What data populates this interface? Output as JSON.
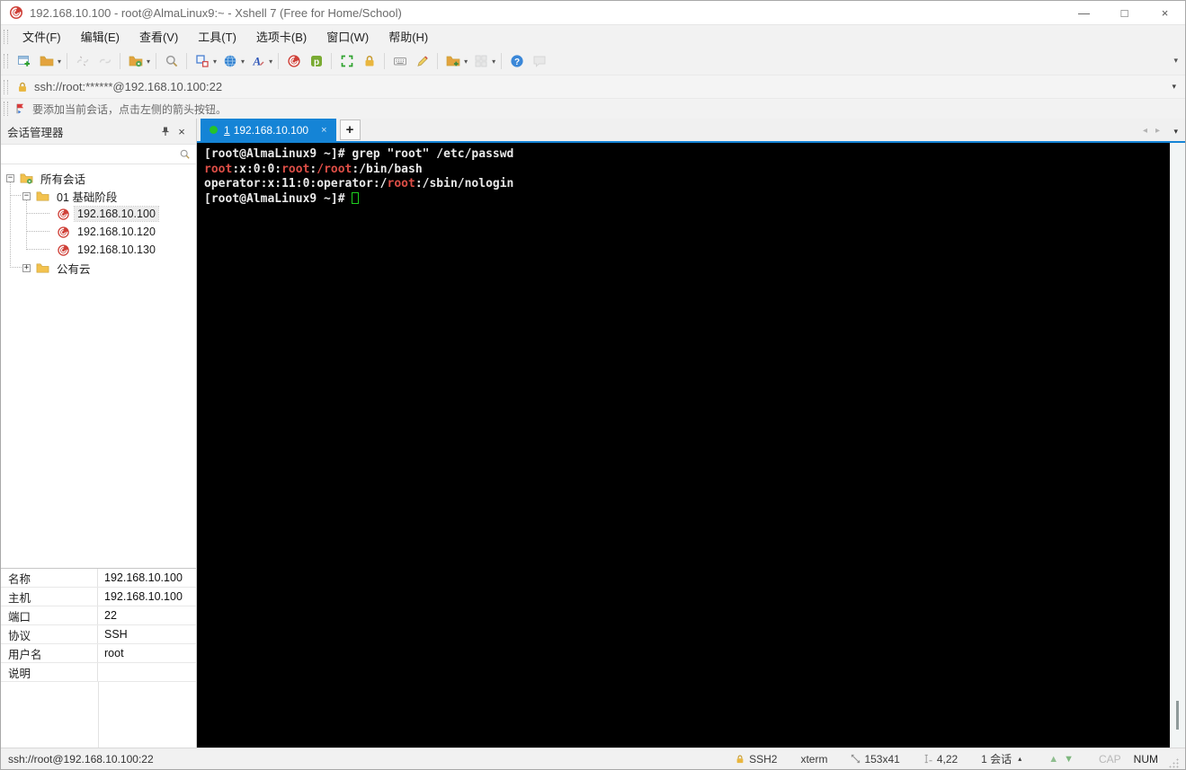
{
  "window": {
    "title": "192.168.10.100 - root@AlmaLinux9:~ - Xshell 7 (Free for Home/School)",
    "minimize": "—",
    "maximize": "□",
    "close": "×"
  },
  "menu_bar": {
    "items": [
      "文件(F)",
      "编辑(E)",
      "查看(V)",
      "工具(T)",
      "选项卡(B)",
      "窗口(W)",
      "帮助(H)"
    ]
  },
  "toolbar": {
    "buttons": [
      {
        "name": "new-session",
        "enabled": true,
        "dropdown": false,
        "sep_after": false
      },
      {
        "name": "open-session",
        "enabled": true,
        "dropdown": true,
        "sep_after": true
      },
      {
        "name": "disconnect",
        "enabled": false,
        "dropdown": false,
        "sep_after": false
      },
      {
        "name": "reconnect",
        "enabled": false,
        "dropdown": false,
        "sep_after": true
      },
      {
        "name": "session-properties",
        "enabled": true,
        "dropdown": true,
        "sep_after": true
      },
      {
        "name": "find",
        "enabled": true,
        "dropdown": false,
        "sep_after": true
      },
      {
        "name": "window-layout",
        "enabled": true,
        "dropdown": true,
        "sep_after": false
      },
      {
        "name": "open-url",
        "enabled": true,
        "dropdown": true,
        "sep_after": false
      },
      {
        "name": "font",
        "enabled": true,
        "dropdown": true,
        "sep_after": true
      },
      {
        "name": "xshell",
        "enabled": true,
        "dropdown": false,
        "sep_after": false
      },
      {
        "name": "xftp",
        "enabled": true,
        "dropdown": false,
        "sep_after": true
      },
      {
        "name": "fullscreen",
        "enabled": true,
        "dropdown": false,
        "sep_after": false
      },
      {
        "name": "lock-screen",
        "enabled": true,
        "dropdown": false,
        "sep_after": true
      },
      {
        "name": "virtual-keyboard",
        "enabled": true,
        "dropdown": false,
        "sep_after": false
      },
      {
        "name": "compose-pane",
        "enabled": true,
        "dropdown": false,
        "sep_after": true
      },
      {
        "name": "quick-commands",
        "enabled": true,
        "dropdown": true,
        "sep_after": false
      },
      {
        "name": "tile-windows",
        "enabled": false,
        "dropdown": true,
        "sep_after": true
      },
      {
        "name": "help",
        "enabled": true,
        "dropdown": false,
        "sep_after": false
      },
      {
        "name": "feedback",
        "enabled": false,
        "dropdown": false,
        "sep_after": false
      }
    ]
  },
  "address_bar": {
    "url": "ssh://root:******@192.168.10.100:22"
  },
  "info_bar": {
    "message": "要添加当前会话，点击左侧的箭头按钮。"
  },
  "session_manager": {
    "title": "会话管理器",
    "search_placeholder": "",
    "tree": [
      {
        "label": "所有会话",
        "type": "root",
        "level": 0,
        "expander": "-",
        "selected": false
      },
      {
        "label": "01 基础阶段",
        "type": "folder",
        "level": 1,
        "expander": "-",
        "selected": false
      },
      {
        "label": "192.168.10.100",
        "type": "session",
        "level": 2,
        "expander": "",
        "selected": true
      },
      {
        "label": "192.168.10.120",
        "type": "session",
        "level": 2,
        "expander": "",
        "selected": false
      },
      {
        "label": "192.168.10.130",
        "type": "session",
        "level": 2,
        "expander": "",
        "selected": false
      },
      {
        "label": "公有云",
        "type": "folder",
        "level": 1,
        "expander": "+",
        "selected": false
      }
    ],
    "properties": [
      {
        "label": "名称",
        "value": "192.168.10.100"
      },
      {
        "label": "主机",
        "value": "192.168.10.100"
      },
      {
        "label": "端口",
        "value": "22"
      },
      {
        "label": "协议",
        "value": "SSH"
      },
      {
        "label": "用户名",
        "value": "root"
      },
      {
        "label": "说明",
        "value": ""
      }
    ]
  },
  "tab_bar": {
    "tabs": [
      {
        "index": "1",
        "label": "192.168.10.100",
        "close": "×",
        "active": true
      }
    ],
    "new_tab_label": "+"
  },
  "terminal": {
    "lines": [
      {
        "segments": [
          {
            "text": "[root@AlmaLinux9 ~]# grep \"root\" /etc/passwd",
            "color": "fg"
          }
        ]
      },
      {
        "segments": [
          {
            "text": "root",
            "color": "red"
          },
          {
            "text": ":x:0:0:",
            "color": "fg"
          },
          {
            "text": "root",
            "color": "red"
          },
          {
            "text": ":",
            "color": "fg"
          },
          {
            "text": "/root",
            "color": "red"
          },
          {
            "text": ":/bin/bash",
            "color": "fg"
          }
        ]
      },
      {
        "segments": [
          {
            "text": "operator:x:11:0:operator:/",
            "color": "fg"
          },
          {
            "text": "root",
            "color": "red"
          },
          {
            "text": ":/sbin/nologin",
            "color": "fg"
          }
        ]
      },
      {
        "segments": [
          {
            "text": "[root@AlmaLinux9 ~]# ",
            "color": "fg"
          }
        ],
        "cursor": true
      }
    ]
  },
  "status_bar": {
    "connection": "ssh://root@192.168.10.100:22",
    "encryption": "SSH2",
    "terminal_type": "xterm",
    "screen_size": "153x41",
    "cursor_position": "4,22",
    "session_count": "1 会话",
    "caps_indicator": "CAP",
    "num_indicator": "NUM"
  },
  "colors": {
    "accent_blue": "#1584d6",
    "terminal_background": "#000000",
    "terminal_foreground": "#e9e9e9",
    "match_red": "#dc4e46",
    "cursor_green": "#1ed01e",
    "tab_status_green": "#25c32a",
    "lock_yellow": "#e9b63e"
  }
}
